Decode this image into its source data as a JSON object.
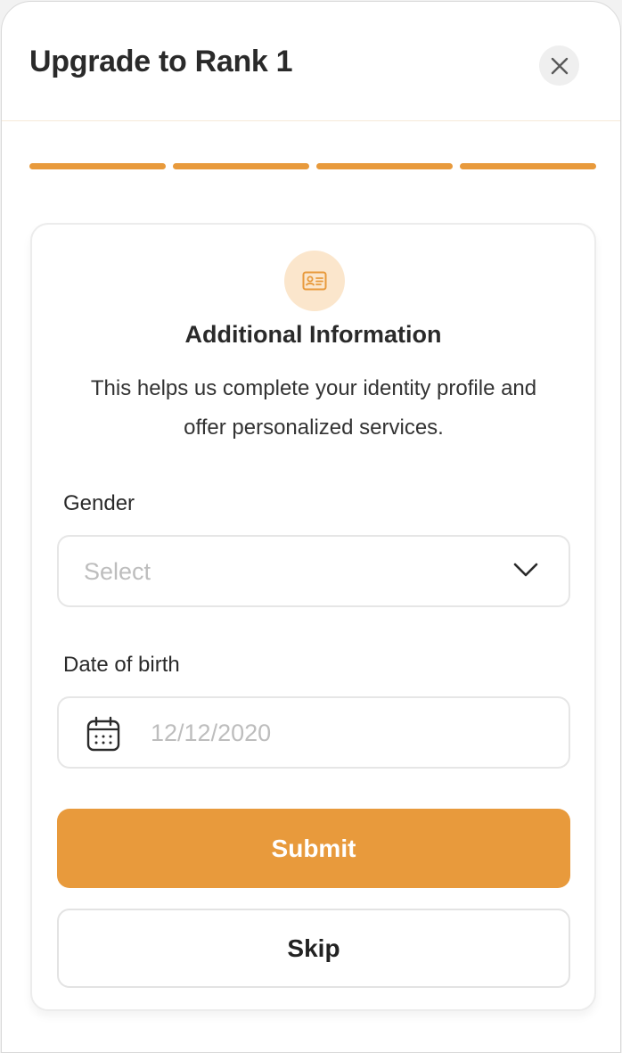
{
  "header": {
    "title": "Upgrade to Rank 1",
    "close_icon": "close-icon"
  },
  "progress": {
    "total_steps": 4,
    "completed_steps": 4,
    "color": "#e89a3c"
  },
  "card": {
    "icon": "id-card-icon",
    "title": "Additional Information",
    "description": "This helps us complete your identity profile and offer personalized services.",
    "gender": {
      "label": "Gender",
      "placeholder": "Select",
      "icon": "chevron-down-icon"
    },
    "dob": {
      "label": "Date of birth",
      "placeholder": "12/12/2020",
      "icon": "calendar-icon"
    },
    "submit_label": "Submit",
    "skip_label": "Skip"
  },
  "colors": {
    "accent": "#e89a3c",
    "accent_light": "#fbe6cc"
  }
}
